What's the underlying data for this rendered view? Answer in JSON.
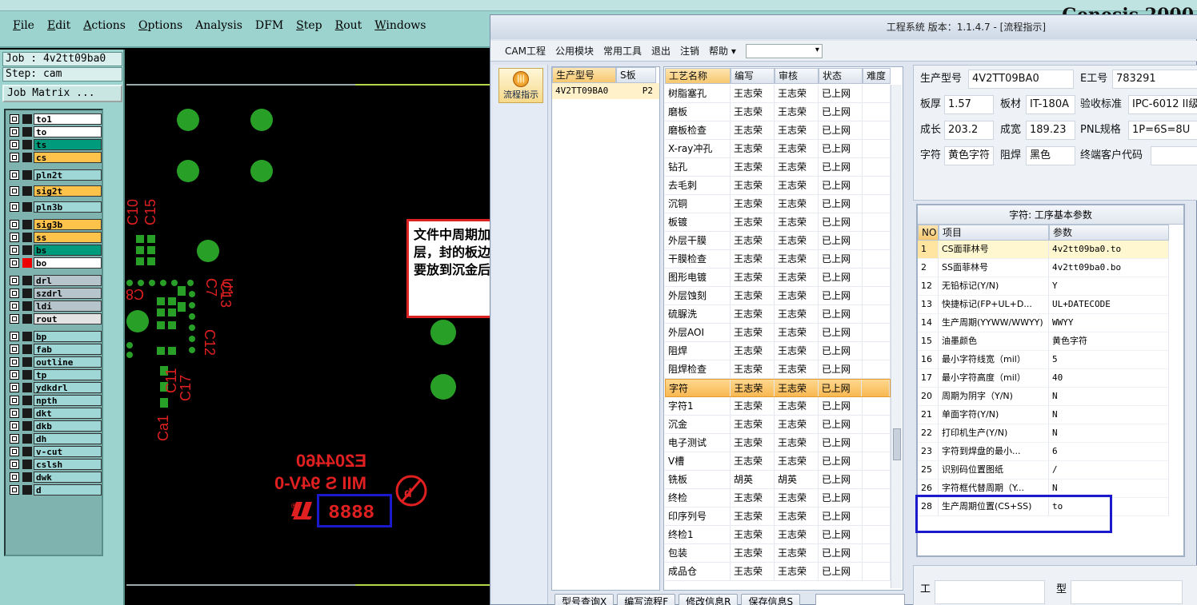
{
  "genesis": {
    "menu": [
      {
        "label": "File",
        "key": "F",
        "rest": "ile"
      },
      {
        "label": "Edit",
        "key": "E",
        "rest": "dit"
      },
      {
        "label": "Actions",
        "key": "A",
        "rest": "ctions"
      },
      {
        "label": "Options",
        "key": "O",
        "rest": "ptions"
      },
      {
        "label": "Analysis",
        "key": "",
        "rest": "Analysis"
      },
      {
        "label": "DFM",
        "key": "",
        "rest": "DFM"
      },
      {
        "label": "Step",
        "key": "S",
        "rest": "tep"
      },
      {
        "label": "Rout",
        "key": "R",
        "rest": "out"
      },
      {
        "label": "Windows",
        "key": "W",
        "rest": "indows"
      }
    ],
    "title": "Genesis 2000",
    "job": "Job : 4v2tt09ba0",
    "step": "Step: cam",
    "matrix_button": "Job Matrix ...",
    "layers": [
      {
        "name": "to1",
        "color": "#ffffff"
      },
      {
        "name": "to",
        "color": "#ffffff"
      },
      {
        "name": "ts",
        "color": "#009b7d"
      },
      {
        "name": "cs",
        "color": "#ffc24a"
      },
      {
        "name": "pln2t",
        "color": "#9fd6d6"
      },
      {
        "name": "sig2t",
        "color": "#ffc24a"
      },
      {
        "name": "pln3b",
        "color": "#9fd6d6"
      },
      {
        "name": "sig3b",
        "color": "#ffc24a"
      },
      {
        "name": "ss",
        "color": "#ffc24a"
      },
      {
        "name": "bs",
        "color": "#009b7d"
      },
      {
        "name": "bo",
        "color": "#ffffff",
        "active": true
      },
      {
        "name": "drl",
        "color": "#b6c4cc"
      },
      {
        "name": "szdrl",
        "color": "#b6c4cc"
      },
      {
        "name": "ldi",
        "color": "#b6c4cc"
      },
      {
        "name": "rout",
        "color": "#e3e3e3"
      },
      {
        "name": "bp",
        "color": "#9fd6d6"
      },
      {
        "name": "fab",
        "color": "#9fd6d6"
      },
      {
        "name": "outline",
        "color": "#9fd6d6"
      },
      {
        "name": "tp",
        "color": "#9fd6d6"
      },
      {
        "name": "ydkdrl",
        "color": "#9fd6d6"
      },
      {
        "name": "npth",
        "color": "#9fd6d6"
      },
      {
        "name": "dkt",
        "color": "#9fd6d6"
      },
      {
        "name": "dkb",
        "color": "#9fd6d6"
      },
      {
        "name": "dh",
        "color": "#9fd6d6"
      },
      {
        "name": "v-cut",
        "color": "#9fd6d6"
      },
      {
        "name": "cslsh",
        "color": "#9fd6d6"
      },
      {
        "name": "dwk",
        "color": "#9fd6d6"
      },
      {
        "name": "d",
        "color": "#9fd6d6"
      }
    ]
  },
  "canvas": {
    "mirror_texts": [
      "E204460",
      "MII S 94V-0",
      "8888"
    ],
    "ref_labels": [
      "C10",
      "C15",
      "C8",
      "C11",
      "C13",
      "C17",
      "C12",
      "C7",
      "U1",
      "Ca1"
    ]
  },
  "annotation": "文件中周期加在底层，erp填写的是顶层，封的板边也是顶层，字符走丝印要不要放到沉金后，请核实",
  "erp": {
    "title": "工程系统  版本：1.1.4.7 - [流程指示]",
    "menu": [
      "CAM工程",
      "公用模块",
      "常用工具",
      "退出",
      "注销",
      "帮助"
    ],
    "side_button": "流程指示",
    "model_header": [
      "生产型号",
      "S板"
    ],
    "model_value": "4V2TT09BA0",
    "model_extra": "P2",
    "process_header": [
      "工艺名称",
      "编写",
      "审核",
      "状态",
      "难度"
    ],
    "processes": [
      [
        "树脂塞孔",
        "王志荣",
        "王志荣",
        "已上网"
      ],
      [
        "磨板",
        "王志荣",
        "王志荣",
        "已上网"
      ],
      [
        "磨板检查",
        "王志荣",
        "王志荣",
        "已上网"
      ],
      [
        "X-ray冲孔",
        "王志荣",
        "王志荣",
        "已上网"
      ],
      [
        "钻孔",
        "王志荣",
        "王志荣",
        "已上网"
      ],
      [
        "去毛刺",
        "王志荣",
        "王志荣",
        "已上网"
      ],
      [
        "沉铜",
        "王志荣",
        "王志荣",
        "已上网"
      ],
      [
        "板镀",
        "王志荣",
        "王志荣",
        "已上网"
      ],
      [
        "外层干膜",
        "王志荣",
        "王志荣",
        "已上网"
      ],
      [
        "干膜检查",
        "王志荣",
        "王志荣",
        "已上网"
      ],
      [
        "图形电镀",
        "王志荣",
        "王志荣",
        "已上网"
      ],
      [
        "外层蚀刻",
        "王志荣",
        "王志荣",
        "已上网"
      ],
      [
        "硫脲洗",
        "王志荣",
        "王志荣",
        "已上网"
      ],
      [
        "外层AOI",
        "王志荣",
        "王志荣",
        "已上网"
      ],
      [
        "阻焊",
        "王志荣",
        "王志荣",
        "已上网"
      ],
      [
        "阻焊检查",
        "王志荣",
        "王志荣",
        "已上网"
      ],
      [
        "字符",
        "王志荣",
        "王志荣",
        "已上网"
      ],
      [
        "字符1",
        "王志荣",
        "王志荣",
        "已上网"
      ],
      [
        "沉金",
        "王志荣",
        "王志荣",
        "已上网"
      ],
      [
        "电子测试",
        "王志荣",
        "王志荣",
        "已上网"
      ],
      [
        "V槽",
        "王志荣",
        "王志荣",
        "已上网"
      ],
      [
        "铣板",
        "胡英",
        "胡英",
        "已上网"
      ],
      [
        "终检",
        "王志荣",
        "王志荣",
        "已上网"
      ],
      [
        "印序列号",
        "王志荣",
        "王志荣",
        "已上网"
      ],
      [
        "终检1",
        "王志荣",
        "王志荣",
        "已上网"
      ],
      [
        "包装",
        "王志荣",
        "王志荣",
        "已上网"
      ],
      [
        "成品仓",
        "王志荣",
        "王志荣",
        "已上网"
      ]
    ],
    "selected_process_index": 16,
    "info": {
      "model_label": "生产型号",
      "model": "4V2TT09BA0",
      "e_label": "E工号",
      "e": "783291",
      "thick_label": "板厚",
      "thick": "1.57",
      "mat_label": "板材",
      "mat": "IT-180A",
      "std_label": "验收标准",
      "std": "IPC-6012 II级",
      "len_label": "成长",
      "len": "203.2",
      "wid_label": "成宽",
      "wid": "189.23",
      "pnl_label": "PNL规格",
      "pnl": "1P=6S=8U",
      "char_label": "字符",
      "char": "黄色字符",
      "mask_label": "阻焊",
      "mask": "黑色",
      "cust_label": "终端客户代码",
      "cust": ""
    },
    "param_title": "字符: 工序基本参数",
    "param_header": [
      "NO",
      "项目",
      "参数"
    ],
    "params": [
      [
        "1",
        "CS面菲林号",
        "4v2tt09ba0.to"
      ],
      [
        "2",
        "SS面菲林号",
        "4v2tt09ba0.bo"
      ],
      [
        "12",
        "无铅标记(Y/N)",
        "Y"
      ],
      [
        "13",
        "快捷标记(FP+UL+D...",
        "UL+DATECODE"
      ],
      [
        "14",
        "生产周期(YYWW/WWYY)",
        "WWYY"
      ],
      [
        "15",
        "油墨颜色",
        "黄色字符"
      ],
      [
        "16",
        "最小字符线宽（mil）",
        "5"
      ],
      [
        "17",
        "最小字符高度（mil）",
        "40"
      ],
      [
        "20",
        "周期为阴字（Y/N)",
        "N"
      ],
      [
        "21",
        "单面字符(Y/N)",
        "N"
      ],
      [
        "22",
        "打印机生产(Y/N)",
        "N"
      ],
      [
        "23",
        "字符到焊盘的最小...",
        "6"
      ],
      [
        "25",
        "识别码位置图纸",
        "/"
      ],
      [
        "26",
        "字符框代替周期（Y...",
        "N"
      ],
      [
        "28",
        "生产周期位置(CS+SS)",
        "to"
      ]
    ],
    "bottom_buttons": [
      "型号查询X",
      "编写流程F",
      "修改信息R",
      "保存信息S"
    ],
    "lower_labels": [
      "工",
      "型"
    ]
  }
}
